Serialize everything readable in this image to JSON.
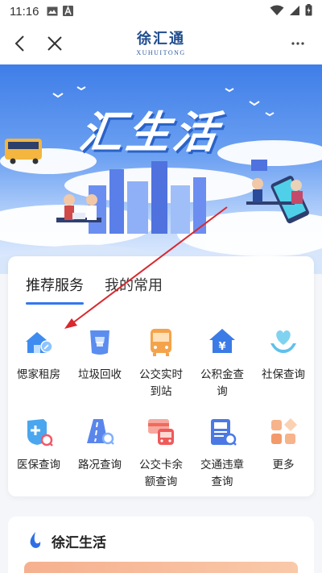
{
  "status_bar": {
    "time": "11:16"
  },
  "nav": {
    "brand_cn": "徐汇通",
    "brand_en": "XUHUITONG"
  },
  "hero": {
    "title": "汇生活"
  },
  "tabs": [
    {
      "label": "推荐服务",
      "active": true
    },
    {
      "label": "我的常用",
      "active": false
    }
  ],
  "services": [
    {
      "label": "愢家租房",
      "icon": "house-key-icon",
      "color": "#3f8cf0"
    },
    {
      "label": "垃圾回收",
      "icon": "trash-bin-icon",
      "color": "#5b8df0"
    },
    {
      "label": "公交实时到站",
      "icon": "bus-icon",
      "color": "#f5a34a"
    },
    {
      "label": "公积金查询",
      "icon": "housing-fund-icon",
      "color": "#3b7be6"
    },
    {
      "label": "社保查询",
      "icon": "heart-hands-icon",
      "color": "#5fc0ec"
    },
    {
      "label": "医保查询",
      "icon": "medical-shield-icon",
      "color": "#4aa6ef"
    },
    {
      "label": "路况查询",
      "icon": "road-search-icon",
      "color": "#5a86ec"
    },
    {
      "label": "公交卡余额查询",
      "icon": "transit-card-icon",
      "color": "#ef6b5d"
    },
    {
      "label": "交通违章查询",
      "icon": "traffic-fine-icon",
      "color": "#4a79e6"
    },
    {
      "label": "更多",
      "icon": "more-grid-icon",
      "color": "#f39a6a"
    }
  ],
  "services_split": {
    "s2": [
      "公交实时",
      "到站"
    ],
    "s3": [
      "公积金查",
      "询"
    ],
    "s7": [
      "公交卡余",
      "额查询"
    ],
    "s8": [
      "交通违章",
      "查询"
    ]
  },
  "section": {
    "title": "徐汇生活"
  },
  "annotation_color": "#d9282f"
}
